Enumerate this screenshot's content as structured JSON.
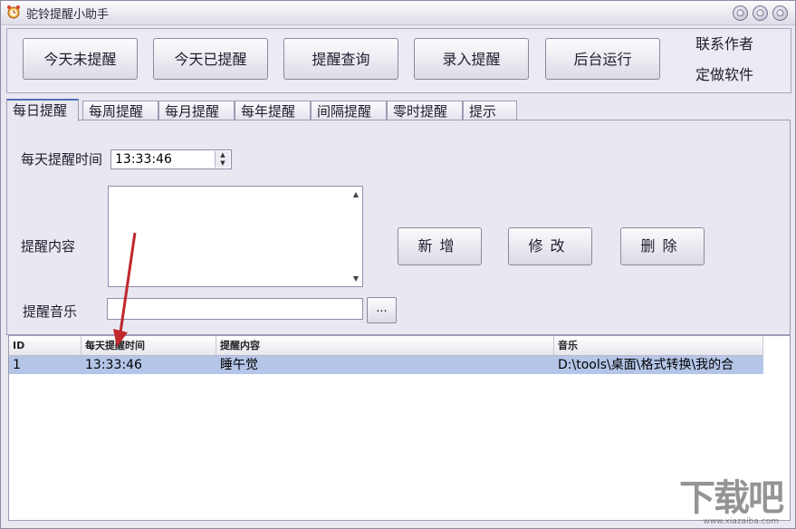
{
  "window": {
    "title": "驼铃提醒小助手",
    "controls": [
      "○",
      "○",
      "○"
    ]
  },
  "toolbar": {
    "buttons": [
      "今天未提醒",
      "今天已提醒",
      "提醒查询",
      "录入提醒",
      "后台运行"
    ],
    "contact": "联系作者",
    "custom": "定做软件"
  },
  "tabs": [
    "每日提醒",
    "每周提醒",
    "每月提醒",
    "每年提醒",
    "间隔提醒",
    "零时提醒",
    "提示"
  ],
  "form": {
    "time_label": "每天提醒时间",
    "time_value": "13:33:46",
    "content_label": "提醒内容",
    "music_label": "提醒音乐",
    "browse_label": "...",
    "add_label": "新增",
    "edit_label": "修改",
    "delete_label": "删除"
  },
  "table": {
    "headers": [
      "ID",
      "每天提醒时间",
      "提醒内容",
      "音乐"
    ],
    "rows": [
      [
        "1",
        "13:33:46",
        "睡午觉",
        "D:\\tools\\桌面\\格式转换\\我的合"
      ]
    ]
  },
  "watermark": {
    "text": "下载吧",
    "url": "www.xiazaiba.com"
  },
  "colors": {
    "selected_row": "#b4c5e8",
    "annotation_arrow": "#c0282d",
    "active_tab_accent": "#4f6fb8"
  }
}
